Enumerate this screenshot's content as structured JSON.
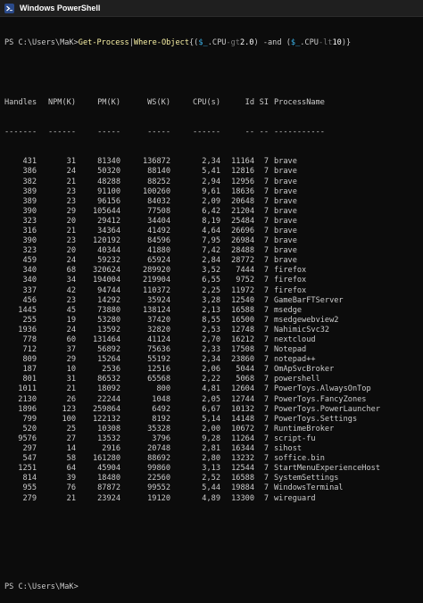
{
  "window": {
    "title": "Windows PowerShell"
  },
  "command": {
    "prompt": "PS C:\\Users\\MaK>",
    "cmdlet": "Get-Process",
    "pipe": "|",
    "filter": "Where-Object",
    "expr_open": "{(",
    "var1": "$_",
    "prop1": ".CPU",
    "op1": "-gt",
    "val1": "2.0",
    "mid": ") -and (",
    "var2": "$_",
    "prop2": ".CPU",
    "op2": "-lt",
    "val2": "10",
    "expr_close": ")}"
  },
  "columns": {
    "handles": "Handles",
    "npm": "NPM(K)",
    "pm": "PM(K)",
    "ws": "WS(K)",
    "cpu": "CPU(s)",
    "id": "Id",
    "si": "SI",
    "name": "ProcessName"
  },
  "dashes": {
    "handles": "-------",
    "npm": "------",
    "pm": "-----",
    "ws": "-----",
    "cpu": "------",
    "id": "--",
    "si": "--",
    "name": "-----------"
  },
  "rows": [
    {
      "handles": "431",
      "npm": "31",
      "pm": "81340",
      "ws": "136872",
      "cpu": "2,34",
      "id": "11164",
      "si": "7",
      "name": "brave"
    },
    {
      "handles": "386",
      "npm": "24",
      "pm": "50320",
      "ws": "88140",
      "cpu": "5,41",
      "id": "12816",
      "si": "7",
      "name": "brave"
    },
    {
      "handles": "382",
      "npm": "21",
      "pm": "48288",
      "ws": "88252",
      "cpu": "2,94",
      "id": "12956",
      "si": "7",
      "name": "brave"
    },
    {
      "handles": "389",
      "npm": "23",
      "pm": "91100",
      "ws": "100260",
      "cpu": "9,61",
      "id": "18636",
      "si": "7",
      "name": "brave"
    },
    {
      "handles": "389",
      "npm": "23",
      "pm": "96156",
      "ws": "84032",
      "cpu": "2,09",
      "id": "20648",
      "si": "7",
      "name": "brave"
    },
    {
      "handles": "390",
      "npm": "29",
      "pm": "105644",
      "ws": "77508",
      "cpu": "6,42",
      "id": "21204",
      "si": "7",
      "name": "brave"
    },
    {
      "handles": "323",
      "npm": "20",
      "pm": "29412",
      "ws": "34404",
      "cpu": "8,19",
      "id": "25484",
      "si": "7",
      "name": "brave"
    },
    {
      "handles": "316",
      "npm": "21",
      "pm": "34364",
      "ws": "41492",
      "cpu": "4,64",
      "id": "26696",
      "si": "7",
      "name": "brave"
    },
    {
      "handles": "390",
      "npm": "23",
      "pm": "120192",
      "ws": "84596",
      "cpu": "7,95",
      "id": "26984",
      "si": "7",
      "name": "brave"
    },
    {
      "handles": "323",
      "npm": "20",
      "pm": "40344",
      "ws": "41880",
      "cpu": "7,42",
      "id": "28488",
      "si": "7",
      "name": "brave"
    },
    {
      "handles": "459",
      "npm": "24",
      "pm": "59232",
      "ws": "65924",
      "cpu": "2,84",
      "id": "28772",
      "si": "7",
      "name": "brave"
    },
    {
      "handles": "340",
      "npm": "68",
      "pm": "320624",
      "ws": "289920",
      "cpu": "3,52",
      "id": "7444",
      "si": "7",
      "name": "firefox"
    },
    {
      "handles": "340",
      "npm": "34",
      "pm": "194004",
      "ws": "219904",
      "cpu": "6,55",
      "id": "9752",
      "si": "7",
      "name": "firefox"
    },
    {
      "handles": "337",
      "npm": "42",
      "pm": "94744",
      "ws": "110372",
      "cpu": "2,25",
      "id": "11972",
      "si": "7",
      "name": "firefox"
    },
    {
      "handles": "456",
      "npm": "23",
      "pm": "14292",
      "ws": "35924",
      "cpu": "3,28",
      "id": "12540",
      "si": "7",
      "name": "GameBarFTServer"
    },
    {
      "handles": "1445",
      "npm": "45",
      "pm": "73880",
      "ws": "138124",
      "cpu": "2,13",
      "id": "16588",
      "si": "7",
      "name": "msedge"
    },
    {
      "handles": "255",
      "npm": "19",
      "pm": "53280",
      "ws": "37420",
      "cpu": "8,55",
      "id": "16500",
      "si": "7",
      "name": "msedgewebview2"
    },
    {
      "handles": "1936",
      "npm": "24",
      "pm": "13592",
      "ws": "32820",
      "cpu": "2,53",
      "id": "12748",
      "si": "7",
      "name": "NahimicSvc32"
    },
    {
      "handles": "778",
      "npm": "60",
      "pm": "131464",
      "ws": "41124",
      "cpu": "2,70",
      "id": "16212",
      "si": "7",
      "name": "nextcloud"
    },
    {
      "handles": "712",
      "npm": "37",
      "pm": "56892",
      "ws": "75636",
      "cpu": "2,33",
      "id": "17508",
      "si": "7",
      "name": "Notepad"
    },
    {
      "handles": "809",
      "npm": "29",
      "pm": "15264",
      "ws": "55192",
      "cpu": "2,34",
      "id": "23860",
      "si": "7",
      "name": "notepad++"
    },
    {
      "handles": "187",
      "npm": "10",
      "pm": "2536",
      "ws": "12516",
      "cpu": "2,06",
      "id": "5044",
      "si": "7",
      "name": "OmApSvcBroker"
    },
    {
      "handles": "801",
      "npm": "31",
      "pm": "86532",
      "ws": "65568",
      "cpu": "2,22",
      "id": "5068",
      "si": "7",
      "name": "powershell"
    },
    {
      "handles": "1011",
      "npm": "21",
      "pm": "18092",
      "ws": "800",
      "cpu": "4,81",
      "id": "12604",
      "si": "7",
      "name": "PowerToys.AlwaysOnTop"
    },
    {
      "handles": "2130",
      "npm": "26",
      "pm": "22244",
      "ws": "1048",
      "cpu": "2,05",
      "id": "12744",
      "si": "7",
      "name": "PowerToys.FancyZones"
    },
    {
      "handles": "1896",
      "npm": "123",
      "pm": "259864",
      "ws": "6492",
      "cpu": "6,67",
      "id": "10132",
      "si": "7",
      "name": "PowerToys.PowerLauncher"
    },
    {
      "handles": "799",
      "npm": "100",
      "pm": "122132",
      "ws": "8192",
      "cpu": "5,14",
      "id": "14148",
      "si": "7",
      "name": "PowerToys.Settings"
    },
    {
      "handles": "520",
      "npm": "25",
      "pm": "10308",
      "ws": "35328",
      "cpu": "2,00",
      "id": "10672",
      "si": "7",
      "name": "RuntimeBroker"
    },
    {
      "handles": "9576",
      "npm": "27",
      "pm": "13532",
      "ws": "3796",
      "cpu": "9,28",
      "id": "11264",
      "si": "7",
      "name": "script-fu"
    },
    {
      "handles": "297",
      "npm": "14",
      "pm": "2916",
      "ws": "20748",
      "cpu": "2,81",
      "id": "16344",
      "si": "7",
      "name": "sihost"
    },
    {
      "handles": "547",
      "npm": "58",
      "pm": "161280",
      "ws": "88692",
      "cpu": "2,80",
      "id": "13232",
      "si": "7",
      "name": "soffice.bin"
    },
    {
      "handles": "1251",
      "npm": "64",
      "pm": "45904",
      "ws": "99860",
      "cpu": "3,13",
      "id": "12544",
      "si": "7",
      "name": "StartMenuExperienceHost"
    },
    {
      "handles": "814",
      "npm": "39",
      "pm": "18480",
      "ws": "22560",
      "cpu": "2,52",
      "id": "16588",
      "si": "7",
      "name": "SystemSettings"
    },
    {
      "handles": "955",
      "npm": "76",
      "pm": "87872",
      "ws": "99552",
      "cpu": "5,44",
      "id": "19884",
      "si": "7",
      "name": "WindowsTerminal"
    },
    {
      "handles": "279",
      "npm": "21",
      "pm": "23924",
      "ws": "19120",
      "cpu": "4,89",
      "id": "13300",
      "si": "7",
      "name": "wireguard"
    }
  ],
  "end_prompt": "PS C:\\Users\\MaK>"
}
